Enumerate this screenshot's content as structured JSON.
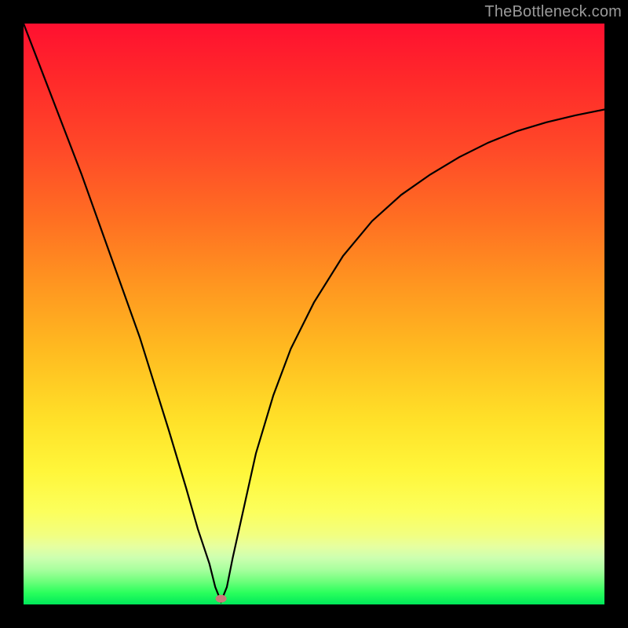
{
  "watermark": "TheBottleneck.com",
  "chart_data": {
    "type": "line",
    "title": "",
    "xlabel": "",
    "ylabel": "",
    "xlim": [
      0,
      100
    ],
    "ylim": [
      0,
      100
    ],
    "grid": false,
    "legend": false,
    "marker": {
      "x": 34,
      "y": 1
    },
    "series": [
      {
        "name": "bottleneck-curve",
        "x": [
          0,
          5,
          10,
          15,
          20,
          25,
          28,
          30,
          32,
          33,
          34,
          35,
          36,
          38,
          40,
          43,
          46,
          50,
          55,
          60,
          65,
          70,
          75,
          80,
          85,
          90,
          95,
          100
        ],
        "y": [
          100,
          87,
          74,
          60,
          46,
          30,
          20,
          13,
          7,
          3,
          0.5,
          3,
          8,
          17,
          26,
          36,
          44,
          52,
          60,
          66,
          70.5,
          74,
          77,
          79.5,
          81.5,
          83,
          84.2,
          85.2
        ]
      }
    ],
    "colors": {
      "top": "#ff1030",
      "mid": "#ffe028",
      "bottom": "#00e85a",
      "curve": "#000000",
      "marker": "#c97a7a",
      "frame": "#000000",
      "watermark": "#9a9a9a"
    }
  }
}
